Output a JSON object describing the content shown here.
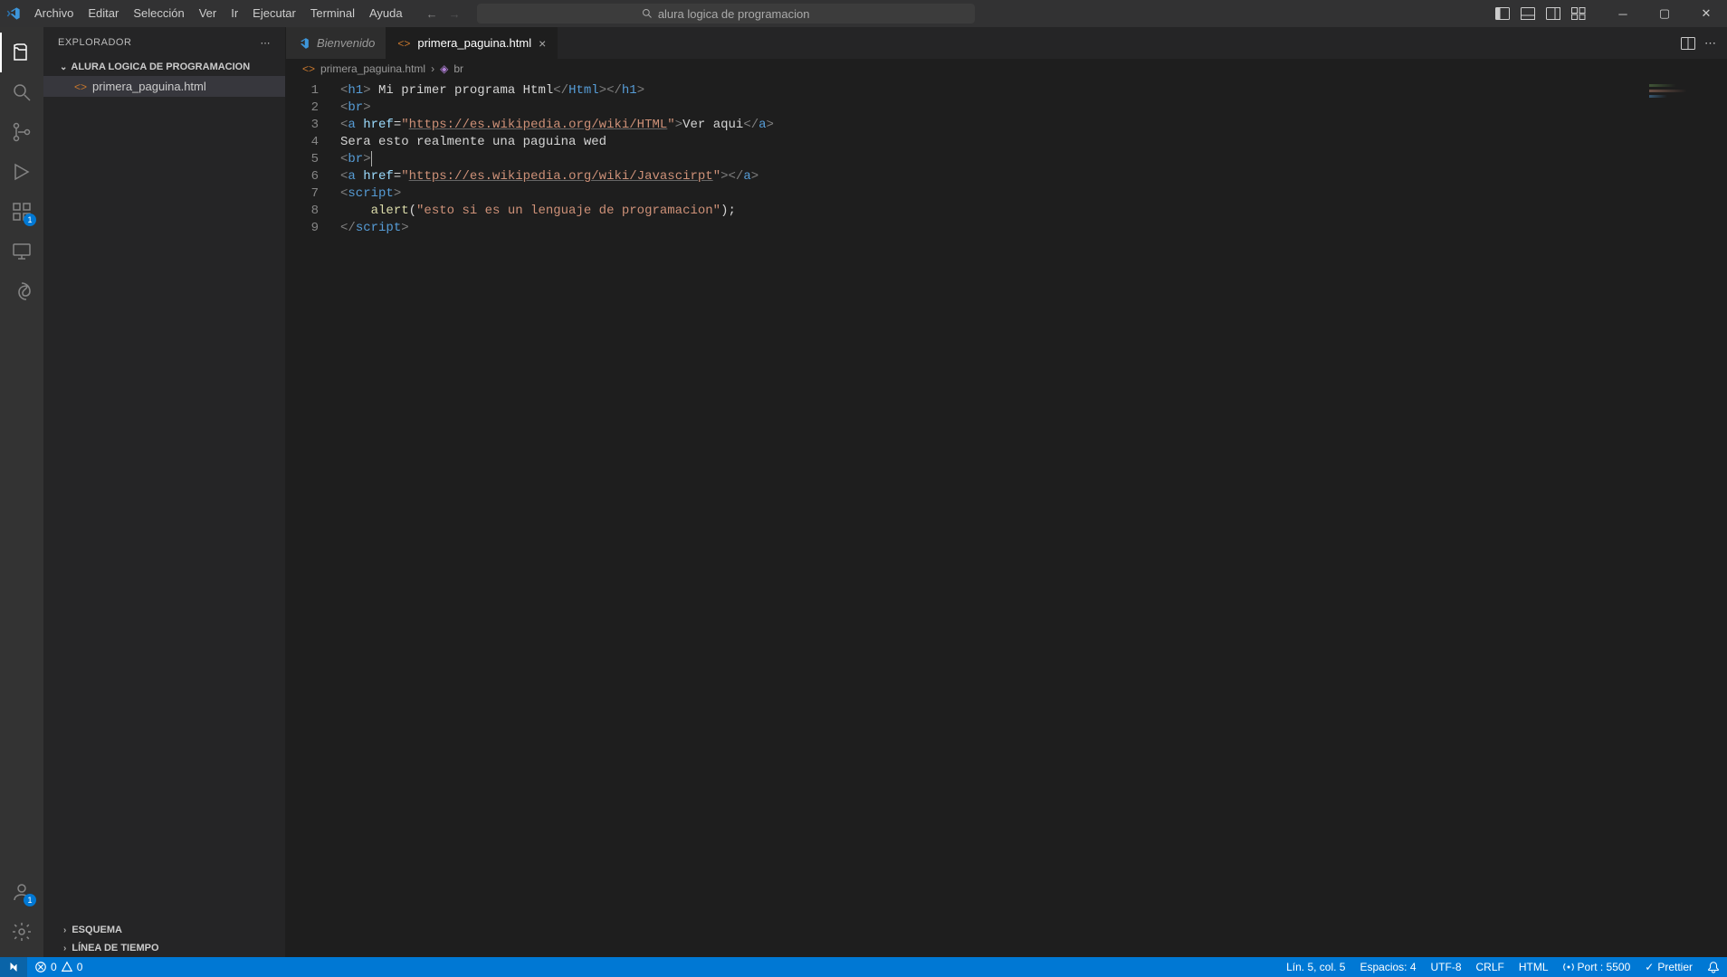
{
  "menu": [
    "Archivo",
    "Editar",
    "Selección",
    "Ver",
    "Ir",
    "Ejecutar",
    "Terminal",
    "Ayuda"
  ],
  "search": {
    "placeholder": "alura logica de programacion"
  },
  "sidebar": {
    "title": "EXPLORADOR",
    "folder": "ALURA LOGICA DE PROGRAMACION",
    "files": [
      "primera_paguina.html"
    ],
    "sections": [
      "ESQUEMA",
      "LÍNEA DE TIEMPO"
    ]
  },
  "activity": {
    "extensions_badge": "1",
    "account_badge": "1"
  },
  "tabs": {
    "list": [
      {
        "label": "Bienvenido",
        "active": false,
        "welcome": true
      },
      {
        "label": "primera_paguina.html",
        "active": true,
        "welcome": false
      }
    ]
  },
  "breadcrumb": {
    "file": "primera_paguina.html",
    "symbol": "br"
  },
  "code": {
    "lines": [
      1,
      2,
      3,
      4,
      5,
      6,
      7,
      8,
      9
    ],
    "l1": {
      "h1": "h1",
      "txt": " Mi primer programa Html",
      "Html": "Html"
    },
    "l2": {
      "br": "br"
    },
    "l3": {
      "a": "a",
      "href": "href",
      "eq": "=",
      "q": "\"",
      "url": "https://es.wikipedia.org/wiki/HTML",
      "txt": "Ver aqui"
    },
    "l4": {
      "txt": "Sera esto realmente una paguina wed"
    },
    "l5": {
      "br": "br"
    },
    "l6": {
      "a": "a",
      "href": "href",
      "eq": "=",
      "q": "\"",
      "url": "https://es.wikipedia.org/wiki/Javascirpt"
    },
    "l7": {
      "script": "script"
    },
    "l8": {
      "fn": "alert",
      "arg": "\"esto si es un lenguaje de programacion\""
    },
    "l9": {
      "script": "script"
    }
  },
  "status": {
    "errors": "0",
    "warnings": "0",
    "cursor": "Lín. 5, col. 5",
    "spaces": "Espacios: 4",
    "encoding": "UTF-8",
    "eol": "CRLF",
    "lang": "HTML",
    "port": "Port : 5500",
    "prettier": "Prettier"
  }
}
